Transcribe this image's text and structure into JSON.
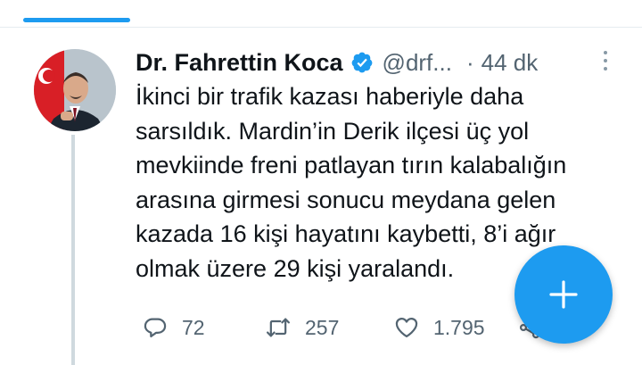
{
  "colors": {
    "accent": "#1d9bf0",
    "text_primary": "#0f1419",
    "text_secondary": "#536471",
    "thread_line": "#cfd9de"
  },
  "tweet": {
    "author": {
      "display_name": "Dr. Fahrettin Koca",
      "handle": "@drf...",
      "verified": true,
      "avatar_icon": "profile-photo"
    },
    "separator": "·",
    "time": "44 dk",
    "text_lines": [
      "İkinci bir trafik kazası haberiyle daha",
      "sarsıldık. Mardin’in Derik ilçesi üç yol",
      "mevkiinde freni patlayan tırın kalabalığın",
      "arasına girmesi sonucu meydana gelen",
      "kazada 16 kişi hayatını kaybetti, 8’i ağır",
      "olmak üzere 29 kişi yaralandı."
    ],
    "actions": {
      "reply_count": "72",
      "retweet_count": "257",
      "like_count": "1.795"
    }
  },
  "fab": {
    "icon": "plus-icon"
  }
}
